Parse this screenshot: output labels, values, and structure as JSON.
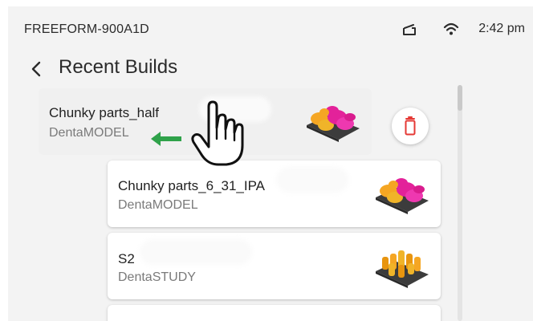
{
  "status_bar": {
    "device_name": "FREEFORM-900A1D",
    "time": "2:42 pm",
    "icons": [
      "tray-icon",
      "wifi-icon"
    ]
  },
  "header": {
    "back_icon": "chevron-left-icon",
    "title": "Recent Builds"
  },
  "builds": [
    {
      "name": "Chunky parts_half",
      "type": "DentaMODEL",
      "thumbnail": "denta-model-thumbnail"
    },
    {
      "name": "Chunky parts_6_31_IPA",
      "type": "DentaMODEL",
      "thumbnail": "denta-model-thumbnail"
    },
    {
      "name": "S2",
      "type": "DentaSTUDY",
      "thumbnail": "denta-study-thumbnail"
    }
  ],
  "row_actions": {
    "delete_icon": "trash-icon"
  },
  "overlays": {
    "swipe_hint_icon": "arrow-left-icon",
    "pointer_icon": "hand-pointer-icon"
  },
  "colors": {
    "accent_red": "#e53935",
    "hint_green": "#2fa24a",
    "model_orange": "#f5a623",
    "model_magenta": "#e3229a",
    "tray_dark": "#3c3c3c"
  }
}
